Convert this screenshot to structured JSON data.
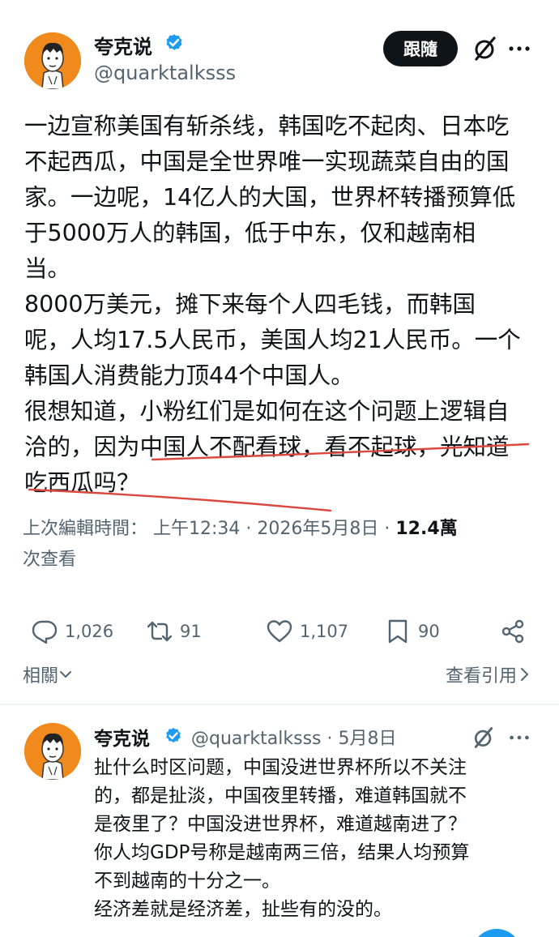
{
  "post": {
    "author_name": "夸克说",
    "handle": "@quarktalksss",
    "follow_label": "跟隨",
    "body_lines": [
      "一边宣称美国有斩杀线，韩国吃不起肉、日本吃",
      "不起西瓜，中国是全世界唯一实现蔬菜自由的国",
      "家。一边呢，14亿人的大国，世界杯转播预算低",
      "于5000万人的韩国，低于中东，仅和越南相",
      "当。",
      "8000万美元，摊下来每个人四毛钱，而韩国",
      "呢，人均17.5人民币，美国人均21人民币。一个",
      "韩国人消费能力顶44个中国人。",
      "很想知道，小粉红们是如何在这个问题上逻辑自",
      "洽的，因为中国人不配看球，看不起球，光知道",
      "吃西瓜吗？"
    ],
    "meta_label": "上次編輯時間：",
    "meta_time": "上午12:34 · 2026年5月8日 · ",
    "meta_views": "12.4萬",
    "meta_views_suffix": "次查看",
    "stats": {
      "replies": "1,026",
      "reposts": "91",
      "likes": "1,107",
      "bookmarks": "90"
    },
    "related_label": "相關",
    "quotes_label": "查看引用"
  },
  "reply": {
    "author_name": "夸克说",
    "handle_date": "@quarktalksss · 5月8日",
    "body_lines": [
      "扯什么时区问题，中国没进世界杯所以不关注",
      "的，都是扯淡，中国夜里转播，难道韩国就不",
      "是夜里了？中国没进世界杯，难道越南进了？",
      "你人均GDP号称是越南两三倍，结果人均预算",
      "不到越南的十分之一。",
      "经济差就是经济差，扯些有的没的。"
    ]
  },
  "colors": {
    "avatar_bg": "#f08a1c",
    "verified_blue": "#1d9bf0",
    "underline_red": "#d9473f",
    "secondary_text": "#536471"
  },
  "icons": [
    "verified-badge-icon",
    "grok-icon",
    "more-icon",
    "reply-icon",
    "repost-icon",
    "like-icon",
    "bookmark-icon",
    "share-icon",
    "chevron-down-icon",
    "chevron-right-icon"
  ]
}
